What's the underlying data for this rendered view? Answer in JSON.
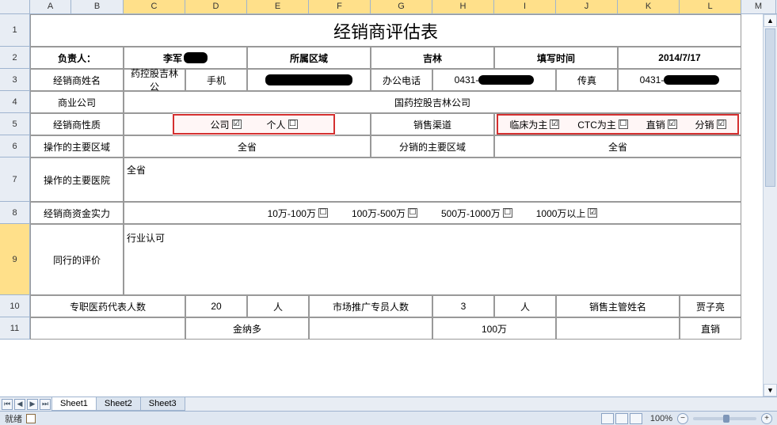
{
  "columns": [
    "A",
    "B",
    "C",
    "D",
    "E",
    "F",
    "G",
    "H",
    "I",
    "J",
    "K",
    "L",
    "M"
  ],
  "rows": [
    "1",
    "2",
    "3",
    "4",
    "5",
    "6",
    "7",
    "8",
    "9",
    "10",
    "11"
  ],
  "selected_row": "9",
  "title": "经销商评估表",
  "row2": {
    "responsible_label": "负责人：",
    "responsible_value": "李军",
    "region_label": "所属区域",
    "region_value": "吉林",
    "time_label": "填写时间",
    "time_value": "2014/7/17"
  },
  "row3": {
    "dealer_name_label": "经销商姓名",
    "dealer_name_value": "药控股吉林公",
    "mobile_label": "手机",
    "office_phone_label": "办公电话",
    "office_phone_value": "0431-",
    "fax_label": "传真",
    "fax_value": "0431-"
  },
  "row4": {
    "company_label": "商业公司",
    "company_value": "国药控股吉林公司"
  },
  "row5": {
    "nature_label": "经销商性质",
    "opt_company": "公司",
    "opt_company_checked": "☑",
    "opt_individual": "个人",
    "opt_individual_checked": "☐",
    "channel_label": "销售渠道",
    "opt_clinical": "临床为主",
    "opt_clinical_checked": "☑",
    "opt_ctc": "CTC为主",
    "opt_ctc_checked": "☐",
    "opt_direct": "直销",
    "opt_direct_checked": "☑",
    "opt_distrib": "分销",
    "opt_distrib_checked": "☑"
  },
  "row6": {
    "op_region_label": "操作的主要区域",
    "op_region_value": "全省",
    "dist_region_label": "分销的主要区域",
    "dist_region_value": "全省"
  },
  "row7": {
    "hospitals_label": "操作的主要医院",
    "hospitals_value": "全省"
  },
  "row8": {
    "capital_label": "经销商资金实力",
    "cap_1": "10万-100万",
    "cap_1_c": "☐",
    "cap_2": "100万-500万",
    "cap_2_c": "☐",
    "cap_3": "500万-1000万",
    "cap_3_c": "☐",
    "cap_4": "1000万以上",
    "cap_4_c": "☑"
  },
  "row9": {
    "peer_label": "同行的评价",
    "peer_value": "行业认可"
  },
  "row10": {
    "rep_count_label": "专职医药代表人数",
    "rep_count_value": "20",
    "unit_people1": "人",
    "promo_label": "市场推广专员人数",
    "promo_value": "3",
    "unit_people2": "人",
    "manager_label": "销售主管姓名",
    "manager_value": "贾子亮"
  },
  "row11": {
    "c1": "金纳多",
    "c2": "100万",
    "c3": "直销"
  },
  "tabs": {
    "s1": "Sheet1",
    "s2": "Sheet2",
    "s3": "Sheet3"
  },
  "status": {
    "ready": "就绪",
    "zoom": "100%"
  },
  "chart_data": {
    "type": "table",
    "title": "经销商评估表",
    "fields": {
      "负责人": "李军",
      "所属区域": "吉林",
      "填写时间": "2014/7/17",
      "经销商姓名": "药控股吉林公",
      "手机": "(redacted)",
      "办公电话": "0431-(redacted)",
      "传真": "0431-(redacted)",
      "商业公司": "国药控股吉林公司",
      "经销商性质": {
        "公司": true,
        "个人": false
      },
      "销售渠道": {
        "临床为主": true,
        "CTC为主": false,
        "直销": true,
        "分销": true
      },
      "操作的主要区域": "全省",
      "分销的主要区域": "全省",
      "操作的主要医院": "全省",
      "经销商资金实力": {
        "10万-100万": false,
        "100万-500万": false,
        "500万-1000万": false,
        "1000万以上": true
      },
      "同行的评价": "行业认可",
      "专职医药代表人数": 20,
      "市场推广专员人数": 3,
      "销售主管姓名": "贾子亮",
      "row11": [
        "金纳多",
        "100万",
        "直销"
      ]
    }
  }
}
